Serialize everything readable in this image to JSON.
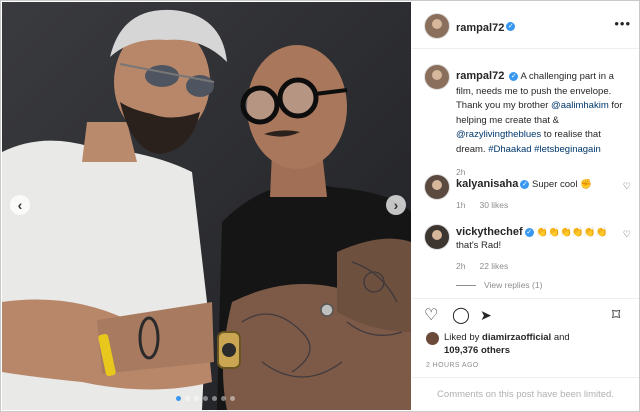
{
  "post": {
    "username": "rampal72",
    "caption_text": "A challenging part in a film, needs me to push the envelope. Thank you my brother ",
    "mention1": "@aalimhakim",
    "caption_mid": " for helping me create that & ",
    "mention2": "@razylivingtheblues",
    "caption_end": " to realise that dream. ",
    "hashtag1": "#Dhaakad",
    "hashtag2": "#letsbeginagain",
    "caption_time": "2h"
  },
  "comments": [
    {
      "username": "kalyanisaha",
      "text": "Super cool ✊",
      "time": "1h",
      "likes": "30 likes"
    },
    {
      "username": "vickythechef",
      "text": "👏👏👏👏👏👏 that's Rad!",
      "time": "2h",
      "likes": "22 likes"
    }
  ],
  "view_replies": "View replies (1)",
  "likes": {
    "liked_by_prefix": "Liked by ",
    "liked_by_user": "diamirzaofficial",
    "and": " and",
    "others": "109,376 others"
  },
  "time_ago": "2 HOURS AGO",
  "comments_limited": "Comments on this post have been limited.",
  "icons": {
    "more": "more-icon",
    "heart": "heart-icon",
    "comment": "comment-icon",
    "share": "share-icon",
    "save": "bookmark-icon",
    "prev": "chevron-left-icon",
    "next": "chevron-right-icon"
  },
  "carousel": {
    "slides": 7,
    "active_index": 0
  },
  "colors": {
    "verified": "#3897f0",
    "link": "#00376b",
    "muted": "#8e8e8e"
  }
}
